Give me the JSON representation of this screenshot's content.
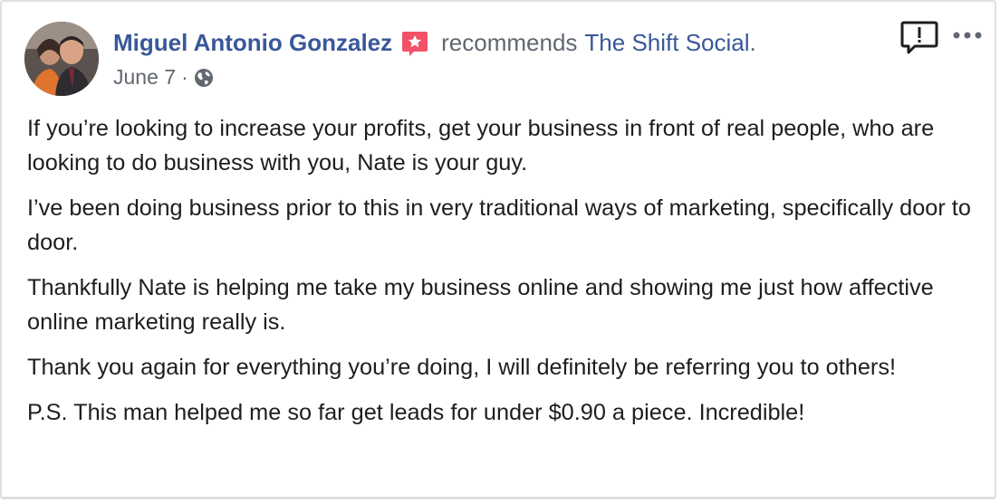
{
  "post": {
    "author": "Miguel Antonio Gonzalez",
    "action": "recommends",
    "page_name": "The Shift Social",
    "page_suffix": ".",
    "date": "June 7",
    "meta_separator": "·",
    "privacy_icon": "globe-icon",
    "badge_icon": "star-badge-icon",
    "report_icon": "report-icon",
    "more_icon": "more-options-icon",
    "paragraphs": [
      "If you’re looking to increase your profits, get your business in front of real people, who are looking to do business with you, Nate is your guy.",
      "I’ve been doing business prior to this in very traditional ways of marketing, specifically door to door.",
      "Thankfully Nate is helping me take my business online and showing me just how affective online marketing really is.",
      "Thank you again for everything you’re doing, I will definitely be referring you to others!",
      "P.S. This man helped me so far get leads for under $0.90 a piece. Incredible!"
    ]
  },
  "colors": {
    "link": "#385898",
    "text": "#1c1e21",
    "muted": "#616770",
    "badge": "#f25268",
    "border": "#dddfe2"
  }
}
